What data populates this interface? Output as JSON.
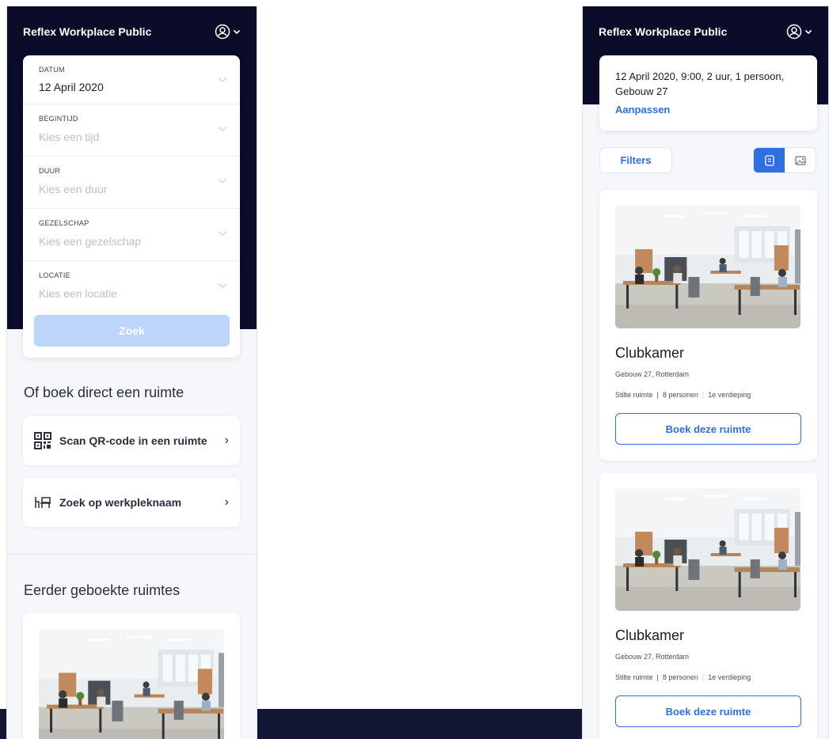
{
  "app": {
    "title": "Reflex Workplace Public"
  },
  "search_form": {
    "fields": [
      {
        "label": "DATUM",
        "value": "12 April 2020",
        "placeholder": ""
      },
      {
        "label": "BEGINTIJD",
        "value": "",
        "placeholder": "Kies een tijd"
      },
      {
        "label": "DUUR",
        "value": "",
        "placeholder": "Kies een duur"
      },
      {
        "label": "GEZELSCHAP",
        "value": "",
        "placeholder": "Kies een gezelschap"
      },
      {
        "label": "LOCATIE",
        "value": "",
        "placeholder": "Kies een locatie"
      }
    ],
    "search_label": "Zoek"
  },
  "direct_booking": {
    "title": "Of boek direct een ruimte",
    "scan_label": "Scan QR-code in een ruimte",
    "search_name_label": "Zoek op werkpleknaam"
  },
  "previous": {
    "title": "Eerder geboekte ruimtes"
  },
  "results": {
    "summary": "12 April 2020, 9:00, 2 uur, 1 persoon, Gebouw 27",
    "adjust_label": "Aanpassen",
    "filters_label": "Filters",
    "rooms": [
      {
        "name": "Clubkamer",
        "location": "Gebouw 27, Rotterdam",
        "type": "Stilte ruimte",
        "capacity": "8 personen",
        "floor": "1e verdieping",
        "book_label": "Boek deze ruimte"
      },
      {
        "name": "Clubkamer",
        "location": "Gebouw 27, Rotterdam",
        "type": "Stilte ruimte",
        "capacity": "8 personen",
        "floor": "1e verdieping",
        "book_label": "Boek deze ruimte"
      }
    ]
  },
  "colors": {
    "navy": "#0b0c2a",
    "accent": "#2f6fe0",
    "disabled_button": "#bcd5fb"
  },
  "icons": {
    "account": "user-circle-icon",
    "dropdown": "chevron-down-icon",
    "scan": "qr-code-icon",
    "workspace": "desk-icon",
    "next": "chevron-right-icon",
    "list_view": "list-view-icon",
    "image_view": "image-view-icon"
  }
}
